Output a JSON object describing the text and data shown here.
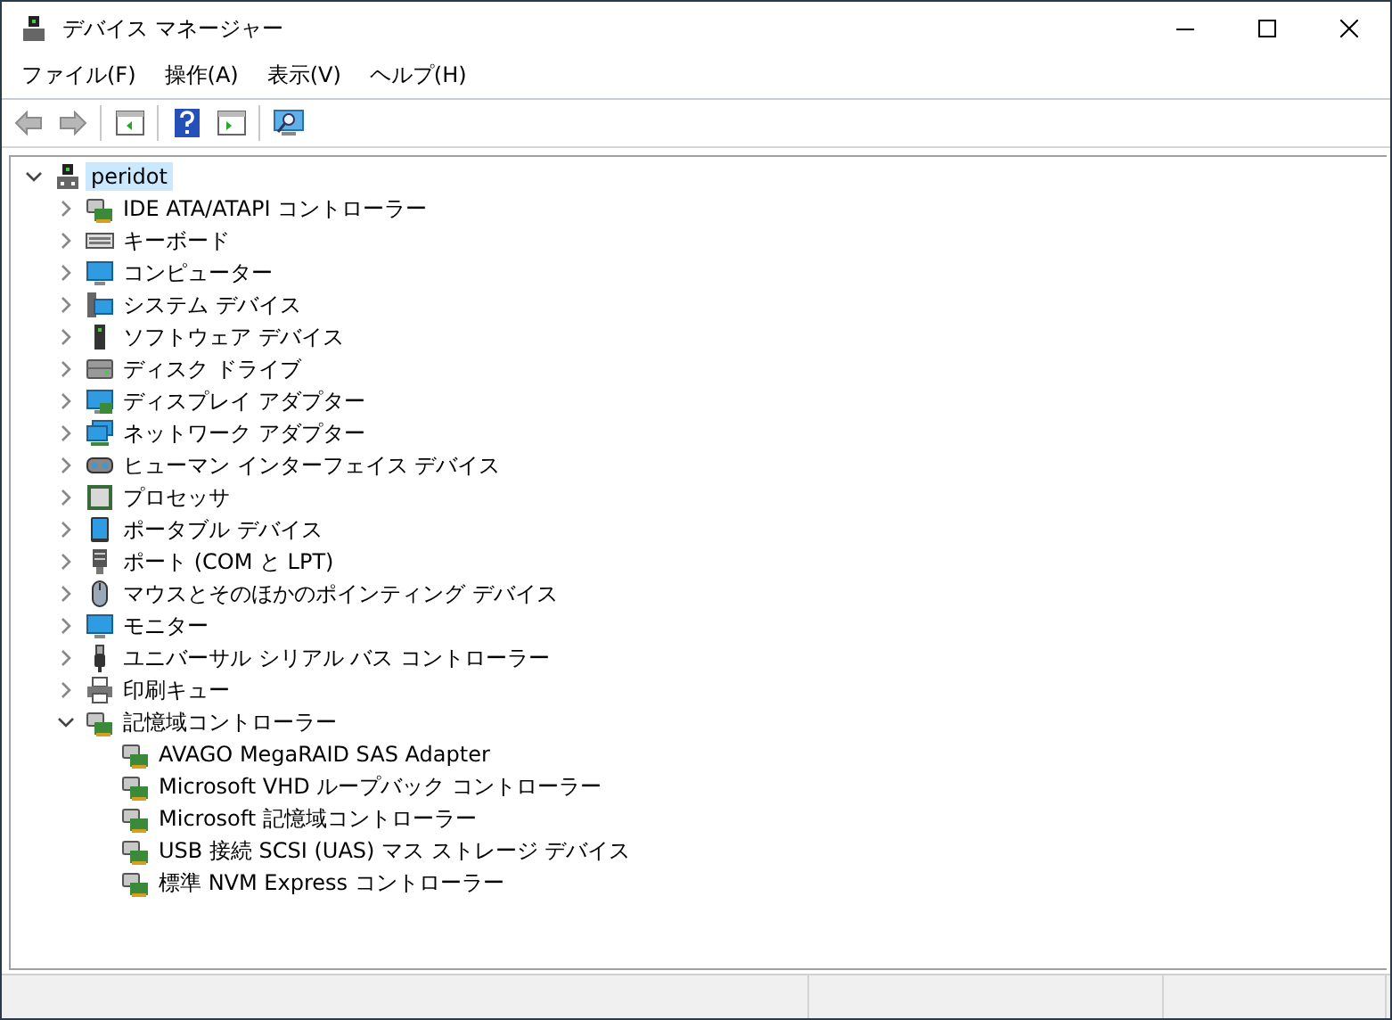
{
  "window": {
    "title": "デバイス マネージャー"
  },
  "menu": [
    {
      "label": "ファイル(F)"
    },
    {
      "label": "操作(A)"
    },
    {
      "label": "表示(V)"
    },
    {
      "label": "ヘルプ(H)"
    }
  ],
  "toolbar": [
    {
      "kind": "back",
      "disabled": true
    },
    {
      "kind": "forward",
      "disabled": true
    },
    {
      "kind": "separator"
    },
    {
      "kind": "panel"
    },
    {
      "kind": "separator"
    },
    {
      "kind": "help"
    },
    {
      "kind": "panel2"
    },
    {
      "kind": "separator"
    },
    {
      "kind": "scan"
    }
  ],
  "tree": {
    "label": "peridot",
    "selected": true,
    "expanded": true,
    "children": [
      {
        "label": "IDE ATA/ATAPI コントローラー",
        "expanded": false
      },
      {
        "label": "キーボード",
        "expanded": false
      },
      {
        "label": "コンピューター",
        "expanded": false
      },
      {
        "label": "システム デバイス",
        "expanded": false
      },
      {
        "label": "ソフトウェア デバイス",
        "expanded": false
      },
      {
        "label": "ディスク ドライブ",
        "expanded": false
      },
      {
        "label": "ディスプレイ アダプター",
        "expanded": false
      },
      {
        "label": "ネットワーク アダプター",
        "expanded": false
      },
      {
        "label": "ヒューマン インターフェイス デバイス",
        "expanded": false
      },
      {
        "label": "プロセッサ",
        "expanded": false
      },
      {
        "label": "ポータブル デバイス",
        "expanded": false
      },
      {
        "label": "ポート (COM と LPT)",
        "expanded": false
      },
      {
        "label": "マウスとそのほかのポインティング デバイス",
        "expanded": false
      },
      {
        "label": "モニター",
        "expanded": false
      },
      {
        "label": "ユニバーサル シリアル バス コントローラー",
        "expanded": false
      },
      {
        "label": "印刷キュー",
        "expanded": false
      },
      {
        "label": "記憶域コントローラー",
        "expanded": true,
        "children": [
          {
            "label": "AVAGO MegaRAID SAS Adapter"
          },
          {
            "label": "Microsoft VHD ループバック コントローラー"
          },
          {
            "label": "Microsoft 記憶域コントローラー"
          },
          {
            "label": "USB 接続 SCSI (UAS) マス ストレージ デバイス"
          },
          {
            "label": "標準 NVM Express コントローラー"
          }
        ]
      }
    ]
  }
}
